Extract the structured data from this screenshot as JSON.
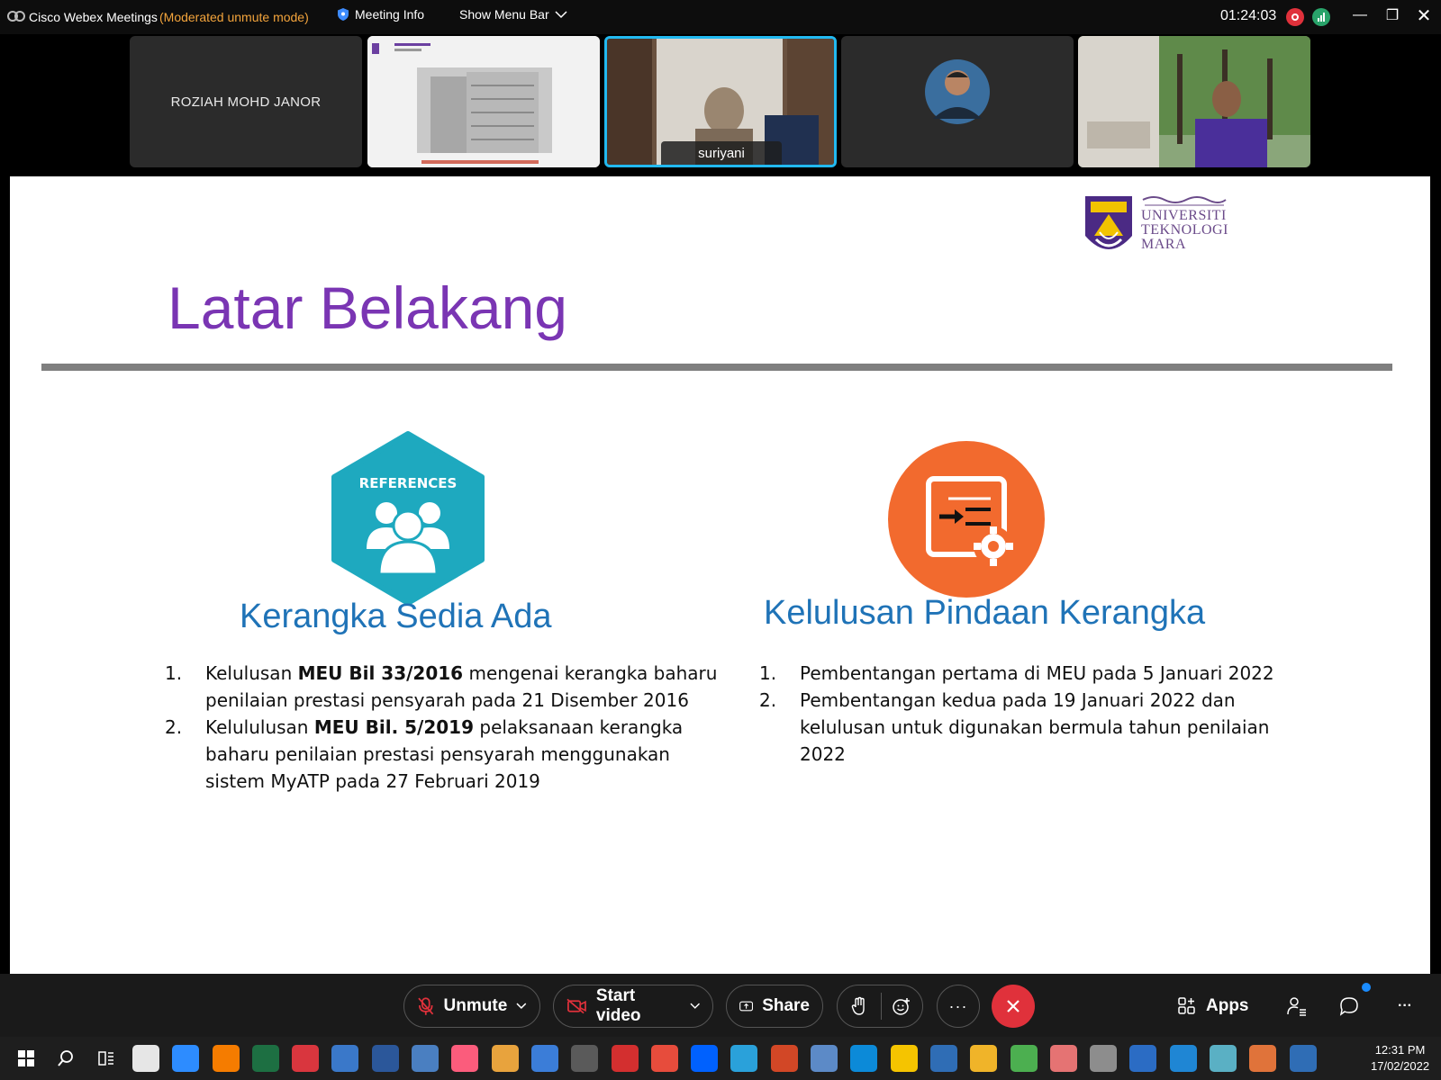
{
  "window": {
    "app_title": "Cisco Webex Meetings",
    "mode_label": "(Moderated unmute mode)",
    "meeting_info_label": "Meeting Info",
    "menu_bar_label": "Show Menu Bar",
    "timer": "01:24:03"
  },
  "participants": [
    {
      "name": "ROZIAH MOHD JANOR",
      "kind": "name-only"
    },
    {
      "name": "",
      "kind": "shared-slide-thumbnail"
    },
    {
      "name": "suriyani",
      "kind": "video",
      "active": true
    },
    {
      "name": "",
      "kind": "avatar"
    },
    {
      "name": "",
      "kind": "video"
    }
  ],
  "slide": {
    "logo_text": [
      "UNIVERSITI",
      "TEKNOLOGI",
      "MARA"
    ],
    "title": "Latar Belakang",
    "left": {
      "icon_label": "REFERENCES",
      "heading": "Kerangka Sedia Ada",
      "items": [
        {
          "num": "1.",
          "pre": "Kelulusan ",
          "bold": "MEU Bil 33/2016",
          "post": " mengenai kerangka baharu",
          "line2": "penilaian prestasi pensyarah  pada 21 Disember 2016"
        },
        {
          "num": "2.",
          "pre": "Kelululusan ",
          "bold": "MEU Bil. 5/2019",
          "post": "  pelaksanaan kerangka",
          "line2": "baharu penilaian prestasi pensyarah menggunakan",
          "line3": "sistem MyATP pada 27 Februari 2019"
        }
      ]
    },
    "right": {
      "heading": "Kelulusan Pindaan Kerangka",
      "items": [
        {
          "num": "1.",
          "line1": "Pembentangan pertama di MEU pada 5 Januari 2022"
        },
        {
          "num": "2.",
          "line1": "Pembentangan kedua pada 19 Januari 2022  dan",
          "line2": "kelulusan untuk digunakan bermula tahun penilaian",
          "line3": "2022"
        }
      ]
    }
  },
  "controls": {
    "unmute": "Unmute",
    "start_video": "Start video",
    "share": "Share",
    "apps": "Apps"
  },
  "taskbar": {
    "time": "12:31 PM",
    "date": "17/02/2022",
    "apps": [
      "start-icon",
      "search-icon",
      "task-view-icon",
      "disk-icon",
      "zoom-icon",
      "vlc-icon",
      "excel-icon",
      "app-red-icon",
      "app-blue-icon",
      "word-icon",
      "calculator-sigma-icon",
      "itunes-icon",
      "paint-icon",
      "explorer-app-icon",
      "calculator-icon",
      "app-red-2-icon",
      "app-circle-icon",
      "dropbox-icon",
      "telegram-icon",
      "powerpoint-icon",
      "laptop-icon",
      "edge-icon",
      "sticky-notes-icon",
      "webex-icon",
      "folder-icon",
      "chrome-icon",
      "paint-3d-icon",
      "voice-recorder-icon",
      "reader-icon",
      "photos-icon",
      "app-teal-icon",
      "app-orange-icon",
      "webex-2-icon"
    ]
  },
  "colors": {
    "title_purple": "#7a35b3",
    "heading_blue": "#1f73b7",
    "active_border": "#22b9f0",
    "end_red": "#e0313b",
    "mode_orange": "#f3a43c"
  }
}
